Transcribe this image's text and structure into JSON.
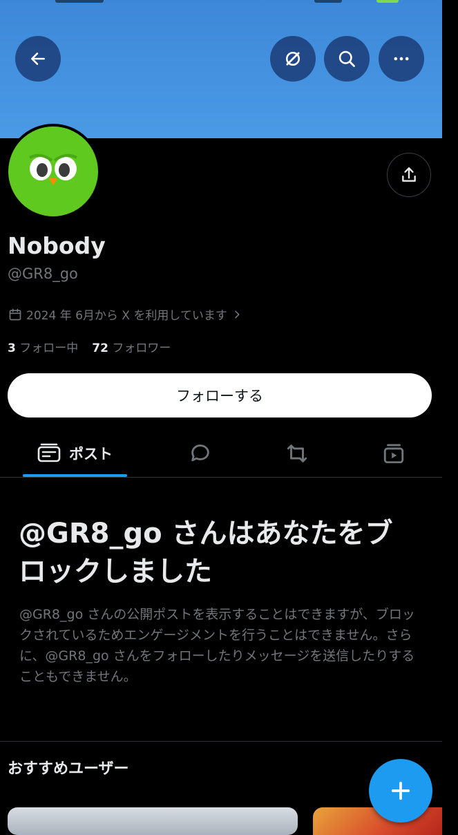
{
  "header": {
    "back_icon": "arrow-left-icon",
    "grok_icon": "grok-icon",
    "search_icon": "search-icon",
    "more_icon": "more-horizontal-icon",
    "banner_color": "#4a9ae6"
  },
  "profile": {
    "name": "Nobody",
    "handle": "@GR8_go",
    "joined": "2024 年 6月から X を利用しています",
    "following_count": "3",
    "following_label": "フォロー中",
    "followers_count": "72",
    "followers_label": "フォロワー",
    "avatar_color": "#5fc91f"
  },
  "actions": {
    "follow_label": "フォローする",
    "share_icon": "share-icon"
  },
  "tabs": [
    {
      "label": "ポスト",
      "icon": "posts-icon",
      "active": true
    },
    {
      "label": "",
      "icon": "reply-icon"
    },
    {
      "label": "",
      "icon": "repost-icon"
    },
    {
      "label": "",
      "icon": "media-icon"
    }
  ],
  "blocked": {
    "title": "@GR8_go さんはあなたをブロックしました",
    "body": "@GR8_go さんの公開ポストを表示することはできますが、ブロックされているためエンゲージメントを行うことはできません。さらに、@GR8_go さんをフォローしたりメッセージを送信したりすることもできません。"
  },
  "recommendations": {
    "title": "おすすめユーザー"
  },
  "fab": {
    "icon": "plus-icon"
  },
  "colors": {
    "accent": "#1d9bf0",
    "muted": "#71767b",
    "text": "#e7e9ea"
  }
}
